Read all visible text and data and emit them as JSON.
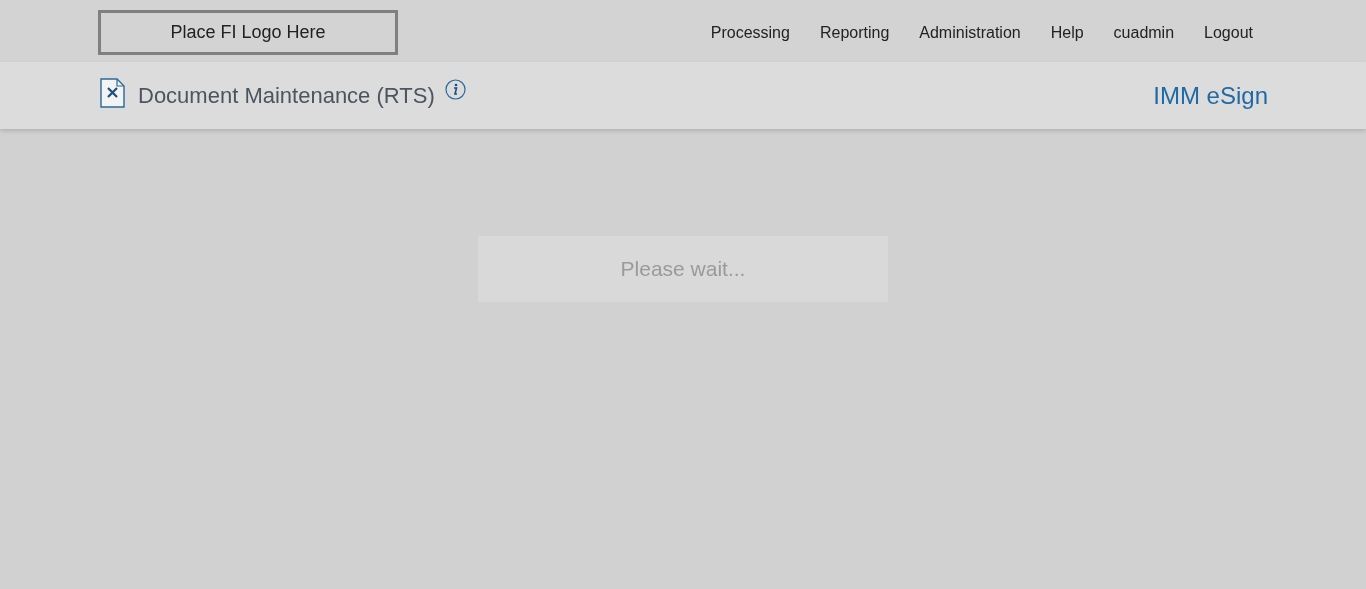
{
  "logo": {
    "text": "Place FI Logo Here"
  },
  "nav": [
    {
      "label": "Processing"
    },
    {
      "label": "Reporting"
    },
    {
      "label": "Administration"
    },
    {
      "label": "Help"
    },
    {
      "label": "cuadmin"
    },
    {
      "label": "Logout"
    }
  ],
  "page_header": {
    "title": "Document Maintenance (RTS)",
    "product": "IMM eSign"
  },
  "loading": {
    "text": "Please wait..."
  }
}
